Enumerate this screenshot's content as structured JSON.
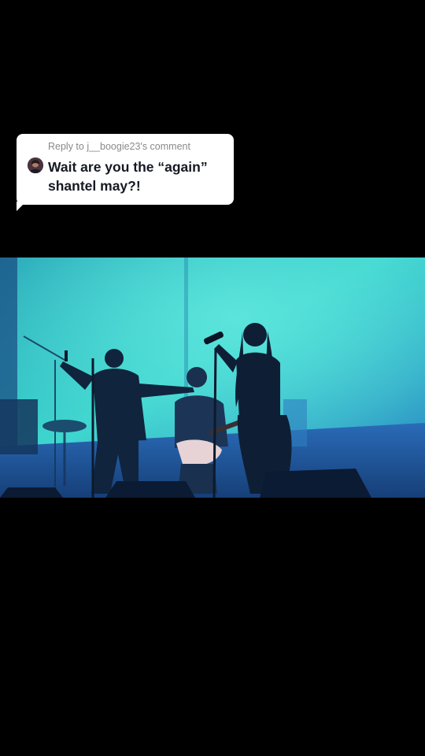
{
  "reply": {
    "header": "Reply to j__boogie23's comment",
    "text": "Wait are you the “again” shantel may?!",
    "avatar_icon": "user-avatar"
  },
  "video": {
    "description_icon": "concert-stage-video"
  },
  "colors": {
    "background": "#000000",
    "bubble": "#ffffff",
    "header_text": "#8a8a8a",
    "comment_text": "#161823",
    "stage_light": "#3fd6cf",
    "stage_dark": "#1e5fa8"
  }
}
